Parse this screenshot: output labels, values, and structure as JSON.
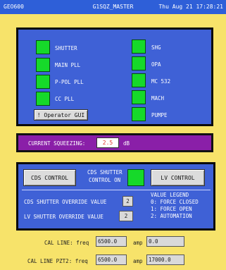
{
  "titlebar": {
    "left": "GEO600",
    "center": "G1SQZ_MASTER",
    "right": "Thu Aug 21 17:28:21"
  },
  "status_panel": {
    "left_items": [
      "SHUTTER",
      "MAIN PLL",
      "P-POL PLL",
      "CC PLL"
    ],
    "right_items": [
      "SHG",
      "OPA",
      "MC 532",
      "MACH",
      "PUMPE"
    ],
    "operator_gui_button": "! Operator GUI",
    "led_color": "#16d92a"
  },
  "squeezing": {
    "label": "CURRENT SQUEEZING:",
    "value": "2.5",
    "unit": "dB"
  },
  "control_panel": {
    "cds_control_button": "CDS CONTROL",
    "lv_control_button": "LV CONTROL",
    "cds_shutter_label_line1": "CDS SHUTTER",
    "cds_shutter_label_line2": "CONTROL ON",
    "cds_override_label": "CDS SHUTTER OVERRIDE VALUE",
    "cds_override_value": "2",
    "lv_override_label": "LV  SHUTTER OVERRIDE VALUE",
    "lv_override_value": "2",
    "legend": [
      "VALUE LEGEND",
      "0: FORCE CLOSED",
      "1: FORCE OPEN",
      "2: AUTOMATION"
    ]
  },
  "cal": {
    "line1_label": "CAL LINE: freq",
    "line1_freq": "6500.0",
    "line1_amp_label": "amp",
    "line1_amp": "0.0",
    "line2_label": "CAL LINE PZT2: freq",
    "line2_freq": "6500.0",
    "line2_amp_label": "amp",
    "line2_amp": "17000.0"
  }
}
